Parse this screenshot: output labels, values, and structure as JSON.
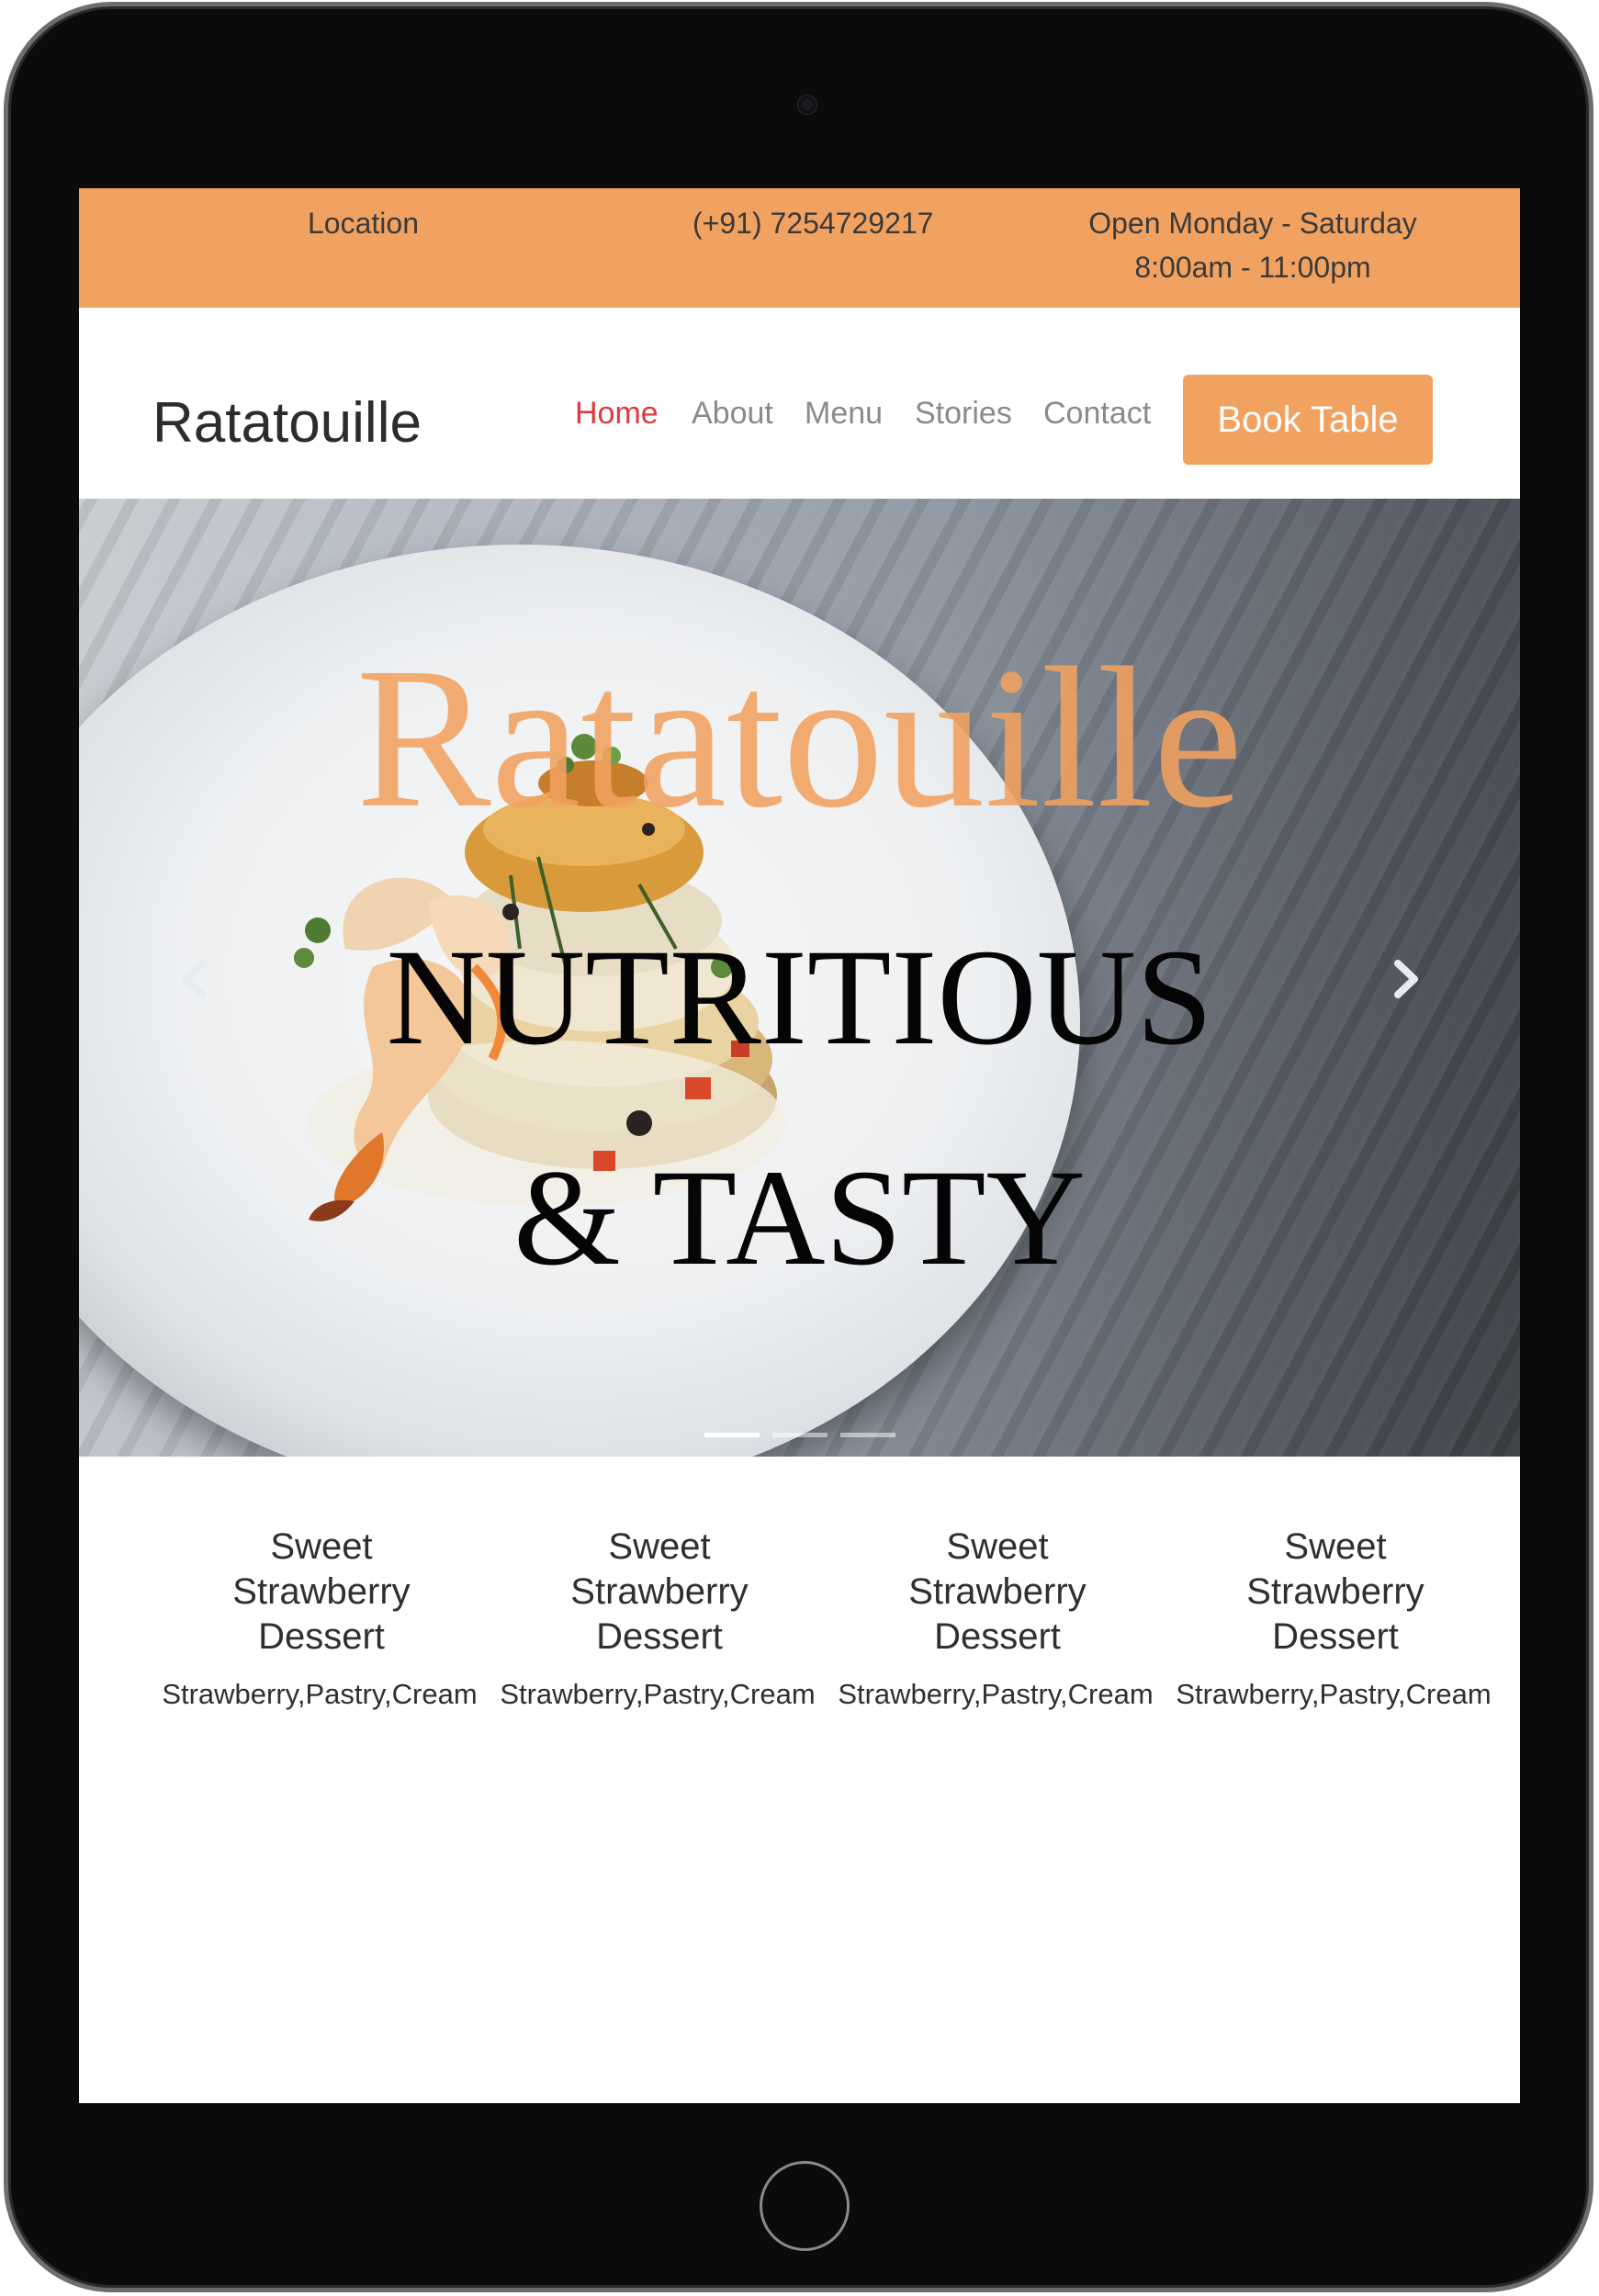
{
  "topbar": {
    "location": "Location",
    "phone": "(+91) 7254729217",
    "hours_line1": "Open Monday - Saturday",
    "hours_line2": "8:00am - 11:00pm"
  },
  "nav": {
    "brand": "Ratatouille",
    "links": [
      "Home",
      "About",
      "Menu",
      "Stories",
      "Contact"
    ],
    "active_link": "Home",
    "book_button": "Book Table"
  },
  "hero": {
    "title": "Ratatouille",
    "subtitle_line1": "NUTRITIOUS",
    "subtitle_line2": "& TASTY",
    "slide_count": 3,
    "active_slide": 1
  },
  "items": [
    {
      "name": "Sweet Strawberry Dessert",
      "description": "Strawberry,Pastry,Cream"
    },
    {
      "name": "Sweet Strawberry Dessert",
      "description": "Strawberry,Pastry,Cream"
    },
    {
      "name": "Sweet Strawberry Dessert",
      "description": "Strawberry,Pastry,Cream"
    },
    {
      "name": "Sweet Strawberry Dessert",
      "description": "Strawberry,Pastry,Cream"
    }
  ],
  "colors": {
    "accent": "#f2a260",
    "active_link": "#e0393e",
    "text_dark": "#2c2c2c",
    "nav_link": "#8a8a8a"
  }
}
